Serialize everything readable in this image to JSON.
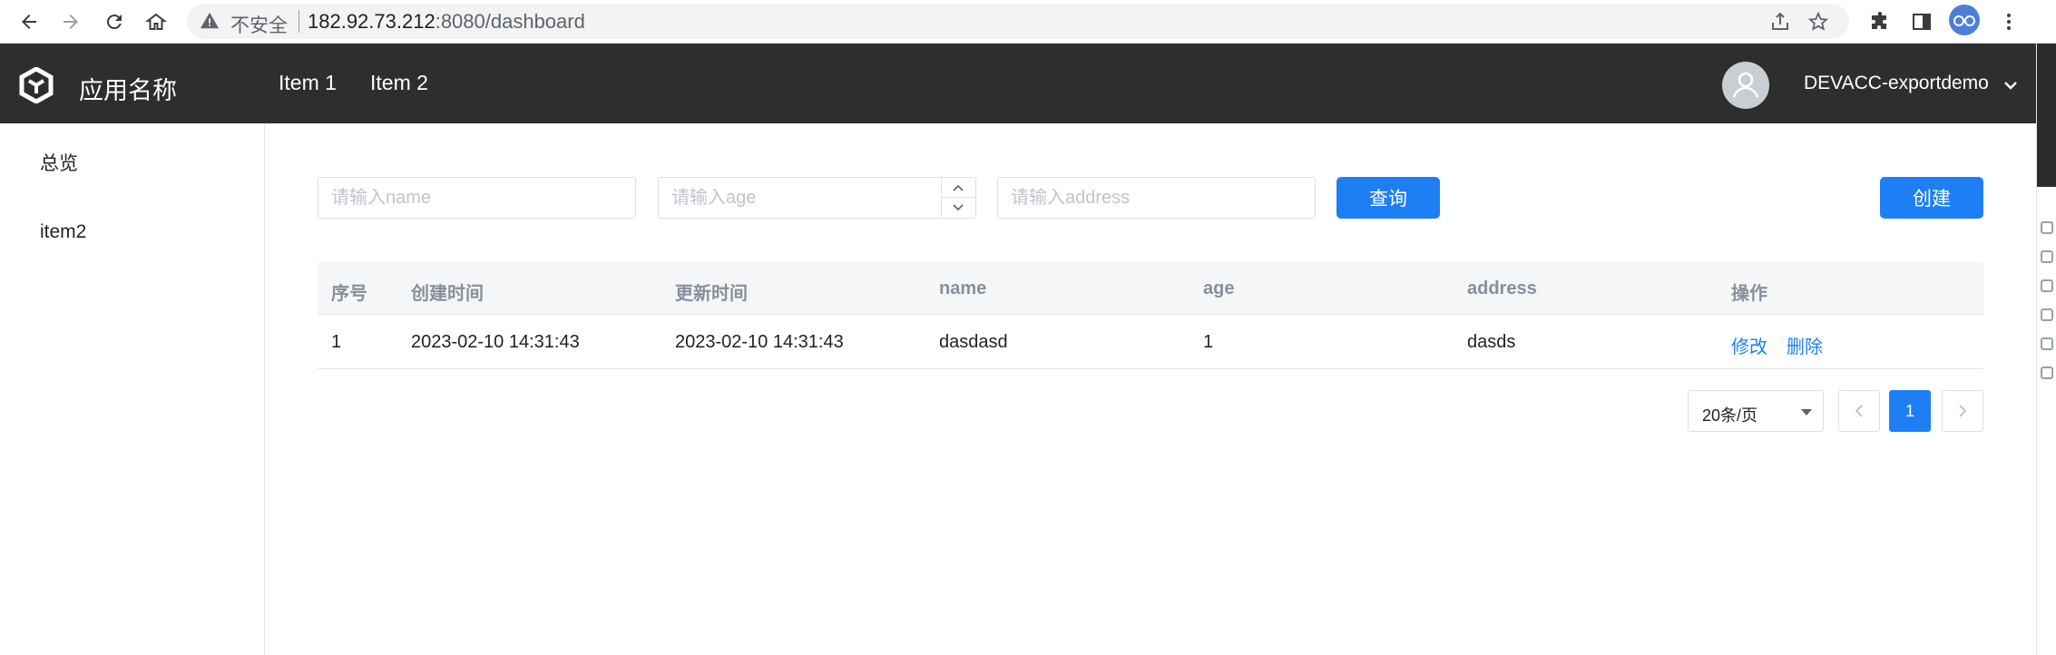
{
  "browser": {
    "insecure_label": "不安全",
    "url_host": "182.92.73.212",
    "url_rest": ":8080/dashboard"
  },
  "header": {
    "app_name": "应用名称",
    "nav": [
      "Item 1",
      "Item 2"
    ],
    "username": "DEVACC-exportdemo"
  },
  "sidebar": {
    "items": [
      {
        "label": "总览"
      },
      {
        "label": "item2"
      }
    ]
  },
  "search": {
    "name_placeholder": "请输入name",
    "age_placeholder": "请输入age",
    "address_placeholder": "请输入address",
    "query_label": "查询",
    "create_label": "创建"
  },
  "table": {
    "columns": [
      "序号",
      "创建时间",
      "更新时间",
      "name",
      "age",
      "address",
      "操作"
    ],
    "rows": [
      {
        "index": "1",
        "created": "2023-02-10 14:31:43",
        "updated": "2023-02-10 14:31:43",
        "name": "dasdasd",
        "age": "1",
        "address": "dasds",
        "edit_label": "修改",
        "delete_label": "删除"
      }
    ]
  },
  "pagination": {
    "page_size": "20条/页",
    "current_page": "1"
  },
  "colors": {
    "header_bg": "#2e2e2e",
    "primary": "#1e7ff5",
    "table_head_bg": "#f5f6f7"
  }
}
